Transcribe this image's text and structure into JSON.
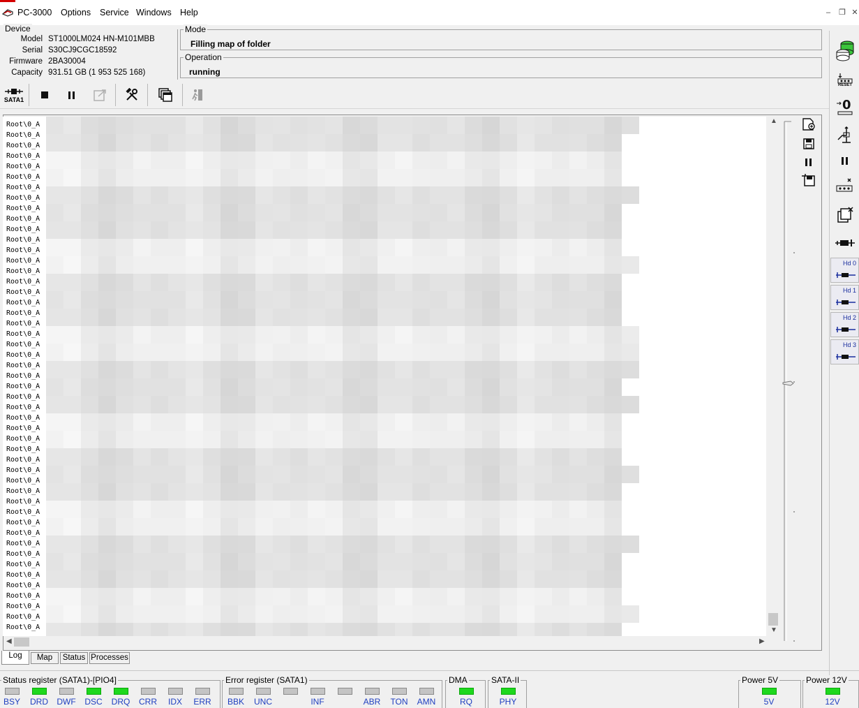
{
  "window": {
    "title": "PC-3000",
    "accent_color": "#d40000",
    "menu": [
      "Options",
      "Service",
      "Windows",
      "Help"
    ],
    "controls": [
      "minimize-icon",
      "restore-icon",
      "close-icon"
    ]
  },
  "device": {
    "legend": "Device",
    "rows": [
      {
        "label": "Model",
        "value": "ST1000LM024 HN-M101MBB"
      },
      {
        "label": "Serial",
        "value": "S30CJ9CGC18592"
      },
      {
        "label": "Firmware",
        "value": "2BA30004"
      },
      {
        "label": "Capacity",
        "value": "931.51 GB (1 953 525 168)"
      }
    ]
  },
  "mode": {
    "legend": "Mode",
    "value": "Filling map of folder"
  },
  "operation": {
    "legend": "Operation",
    "value": "running"
  },
  "toolbar": {
    "port_label": "SATA1",
    "buttons": [
      "stop-icon",
      "pause-icon",
      "export-icon",
      "tools-icon",
      "copy-windows-icon",
      "exit-icon"
    ]
  },
  "log": {
    "line_text": "Root\\0_A",
    "line_count": 49,
    "note_icons": [
      "open-log-icon",
      "save-icon",
      "pause-icon",
      "save-as-icon"
    ]
  },
  "tabs": [
    {
      "label": "Log",
      "active": true
    },
    {
      "label": "Map",
      "active": false
    },
    {
      "label": "Status",
      "active": false
    },
    {
      "label": "Processes",
      "active": false
    }
  ],
  "sidebar": {
    "buttons": [
      "database-icon",
      "reset-icon",
      "zero-icon",
      "power-icon",
      "pause-icon",
      "jumper-icon",
      "clone-icon",
      "connector-icon"
    ],
    "reset_label": "RESET",
    "hd_buttons": [
      "Hd 0",
      "Hd 1",
      "Hd 2",
      "Hd 3"
    ]
  },
  "status": {
    "status_register": {
      "title": "Status register (SATA1)-[PIO4]",
      "leds": [
        {
          "name": "BSY",
          "on": false
        },
        {
          "name": "DRD",
          "on": true
        },
        {
          "name": "DWF",
          "on": false
        },
        {
          "name": "DSC",
          "on": true
        },
        {
          "name": "DRQ",
          "on": true
        },
        {
          "name": "CRR",
          "on": false
        },
        {
          "name": "IDX",
          "on": false
        },
        {
          "name": "ERR",
          "on": false
        }
      ]
    },
    "error_register": {
      "title": "Error register (SATA1)",
      "leds": [
        {
          "name": "BBK",
          "on": false
        },
        {
          "name": "UNC",
          "on": false
        },
        {
          "name": "",
          "on": false
        },
        {
          "name": "INF",
          "on": false
        },
        {
          "name": "",
          "on": false
        },
        {
          "name": "ABR",
          "on": false
        },
        {
          "name": "TON",
          "on": false
        },
        {
          "name": "AMN",
          "on": false
        }
      ]
    },
    "dma": {
      "title": "DMA",
      "leds": [
        {
          "name": "RQ",
          "on": true
        }
      ]
    },
    "sata": {
      "title": "SATA-II",
      "leds": [
        {
          "name": "PHY",
          "on": true
        }
      ]
    },
    "power5": {
      "title": "Power 5V",
      "leds": [
        {
          "name": "5V",
          "on": true
        }
      ]
    },
    "power12": {
      "title": "Power 12V",
      "leds": [
        {
          "name": "12V",
          "on": true
        }
      ]
    },
    "led_on_color": "#1ed81e",
    "led_off_color": "#c4c4c4"
  }
}
